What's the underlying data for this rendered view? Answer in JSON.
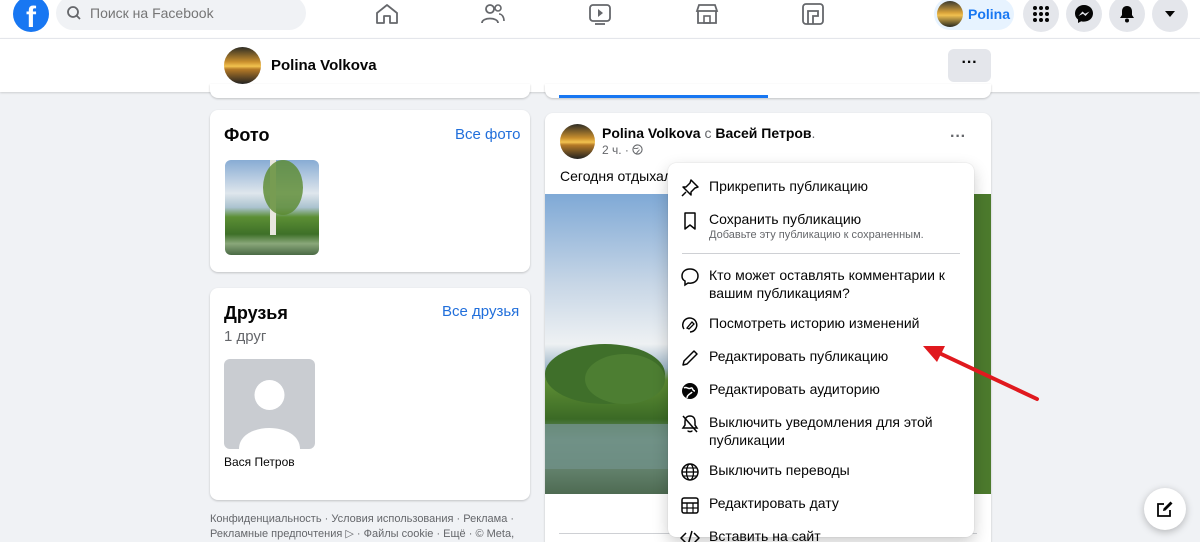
{
  "header": {
    "search_placeholder": "Поиск на Facebook",
    "profile_name": "Polina",
    "logo_letter": "f"
  },
  "profile_bar": {
    "name": "Polina Volkova",
    "more": "···"
  },
  "photos_card": {
    "title": "Фото",
    "link": "Все фото"
  },
  "friends_card": {
    "title": "Друзья",
    "link": "Все друзья",
    "count": "1 друг",
    "friend_name": "Вася Петров"
  },
  "footer": {
    "text": "Конфиденциальность · Условия использования · Реклама · Рекламные предпочтения ▷ · Файлы cookie · Ещё · © Meta,"
  },
  "post": {
    "author": "Polina Volkova",
    "with_word": "с",
    "tagged": "Васей Петров",
    "time": "2 ч. ·",
    "text": "Сегодня отдыхала",
    "dots": "···"
  },
  "menu": {
    "items": [
      {
        "label": "Прикрепить публикацию",
        "icon": "pin-icon"
      },
      {
        "label": "Сохранить публикацию",
        "sub": "Добавьте эту публикацию к сохраненным.",
        "icon": "bookmark-icon"
      },
      {
        "label": "Кто может оставлять комментарии к вашим публикациям?",
        "icon": "comment-icon"
      },
      {
        "label": "Посмотреть историю изменений",
        "icon": "history-icon"
      },
      {
        "label": "Редактировать публикацию",
        "icon": "pencil-icon"
      },
      {
        "label": "Редактировать аудиторию",
        "icon": "globe-icon"
      },
      {
        "label": "Выключить уведомления для этой публикации",
        "icon": "bell-off-icon"
      },
      {
        "label": "Выключить переводы",
        "icon": "translate-globe-icon"
      },
      {
        "label": "Редактировать дату",
        "icon": "calendar-icon"
      },
      {
        "label": "Вставить на сайт",
        "icon": "code-icon"
      }
    ]
  },
  "colors": {
    "accent": "#1877f2",
    "link": "#216fdb",
    "annotation_arrow": "#e0191e"
  }
}
